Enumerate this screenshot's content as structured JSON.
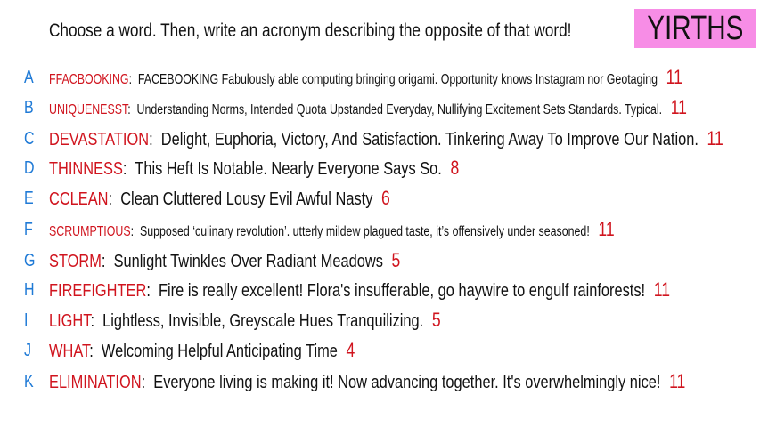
{
  "title": "Choose a word. Then, write an acronym describing the opposite of that word!",
  "badge": "YIRTHS",
  "colors": {
    "letter": "#1f7ad6",
    "word": "#d0141e",
    "badge_bg": "#f78de6"
  },
  "rows": [
    {
      "letter": "A",
      "word": "FFACBOOKING",
      "acronym": "FACEBOOKING Fabulously able computing bringing origami. Opportunity knows Instagram nor Geotaging",
      "score": "11"
    },
    {
      "letter": "B",
      "word": "UNIQUENESST",
      "acronym": "Understanding Norms, Intended Quota Upstanded Everyday, Nullifying Excitement Sets Standards. Typical.",
      "score": "11"
    },
    {
      "letter": "C",
      "word": "DEVASTATION",
      "acronym": "Delight, Euphoria, Victory, And Satisfaction. Tinkering Away To Improve Our Nation.",
      "score": "11"
    },
    {
      "letter": "D",
      "word": "THINNESS",
      "acronym": "This Heft Is Notable. Nearly Everyone Says So.",
      "score": "8"
    },
    {
      "letter": "E",
      "word": "CCLEAN",
      "acronym": "Clean Cluttered Lousy Evil Awful Nasty",
      "score": "6"
    },
    {
      "letter": "F",
      "word": "SCRUMPTIOUS",
      "acronym": "Supposed ‘culinary revolution’. utterly mildew plagued taste, it’s offensively under seasoned!",
      "score": "11"
    },
    {
      "letter": "G",
      "word": "STORM",
      "acronym": "Sunlight Twinkles Over Radiant Meadows",
      "score": "5"
    },
    {
      "letter": "H",
      "word": "FIREFIGHTER",
      "acronym": "Fire is really excellent! Flora's insufferable, go haywire to engulf rainforests!",
      "score": "11"
    },
    {
      "letter": "I",
      "word": "LIGHT",
      "acronym": "Lightless, Invisible, Greyscale Hues Tranquilizing.",
      "score": "5"
    },
    {
      "letter": "J",
      "word": "WHAT",
      "acronym": "Welcoming Helpful Anticipating Time",
      "score": "4"
    },
    {
      "letter": "K",
      "word": "ELIMINATION",
      "acronym": "Everyone living is making it! Now advancing together. It's overwhelmingly nice!",
      "score": "11"
    }
  ]
}
